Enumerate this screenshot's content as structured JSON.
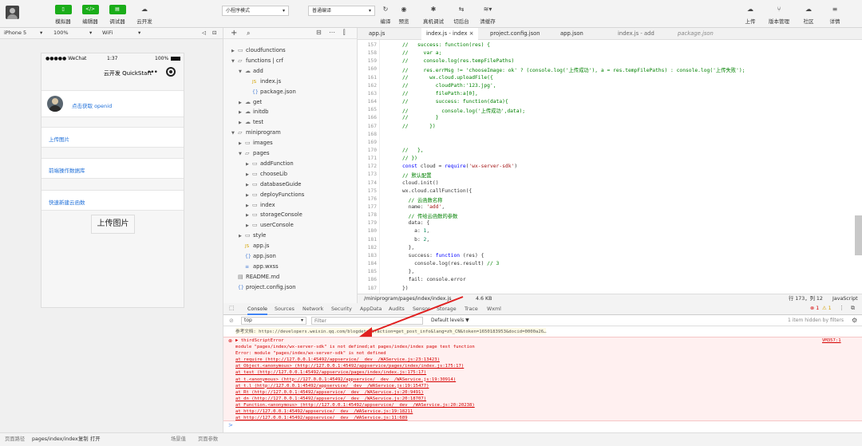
{
  "toolbar": {
    "simulator": "模拟器",
    "editor": "编辑器",
    "debugger": "调试器",
    "cloud": "云开发",
    "mode": "小程序模式",
    "compile": "普通编译",
    "compile_btn": "编译",
    "preview_btn": "预览",
    "remote_debug": "真机调试",
    "background": "切后台",
    "clear_cache": "清缓存",
    "upload": "上传",
    "version": "版本管理",
    "community": "社区",
    "details": "详情"
  },
  "device": {
    "model": "iPhone 5",
    "zoom": "100%",
    "network": "WiFi"
  },
  "phone": {
    "carrier": "●●●●● WeChat",
    "time": "1:37",
    "battery": "100%",
    "title": "云开发 QuickStart",
    "openid_link": "点击获取 openid",
    "upload_image": "上传图片",
    "db_guide": "前端操作数据库",
    "new_cloud_fn": "快速新建云函数",
    "upload_button": "上传图片"
  },
  "tree": [
    {
      "label": "cloudfunctions",
      "indent": 0,
      "arrow": "▶",
      "icon": "folder"
    },
    {
      "label": "functions | crf",
      "indent": 0,
      "arrow": "▼",
      "icon": "folder-open"
    },
    {
      "label": "add",
      "indent": 1,
      "arrow": "▼",
      "icon": "cloud"
    },
    {
      "label": "index.js",
      "indent": 2,
      "arrow": "",
      "icon": "js"
    },
    {
      "label": "package.json",
      "indent": 2,
      "arrow": "",
      "icon": "json"
    },
    {
      "label": "get",
      "indent": 1,
      "arrow": "▶",
      "icon": "cloud"
    },
    {
      "label": "initdb",
      "indent": 1,
      "arrow": "▶",
      "icon": "cloud"
    },
    {
      "label": "test",
      "indent": 1,
      "arrow": "▶",
      "icon": "cloud"
    },
    {
      "label": "miniprogram",
      "indent": 0,
      "arrow": "▼",
      "icon": "folder-open"
    },
    {
      "label": "images",
      "indent": 1,
      "arrow": "▶",
      "icon": "folder"
    },
    {
      "label": "pages",
      "indent": 1,
      "arrow": "▼",
      "icon": "folder-open"
    },
    {
      "label": "addFunction",
      "indent": 2,
      "arrow": "▶",
      "icon": "folder"
    },
    {
      "label": "chooseLib",
      "indent": 2,
      "arrow": "▶",
      "icon": "folder"
    },
    {
      "label": "databaseGuide",
      "indent": 2,
      "arrow": "▶",
      "icon": "folder"
    },
    {
      "label": "deployFunctions",
      "indent": 2,
      "arrow": "▶",
      "icon": "folder"
    },
    {
      "label": "index",
      "indent": 2,
      "arrow": "▶",
      "icon": "folder"
    },
    {
      "label": "storageConsole",
      "indent": 2,
      "arrow": "▶",
      "icon": "folder"
    },
    {
      "label": "userConsole",
      "indent": 2,
      "arrow": "▶",
      "icon": "folder"
    },
    {
      "label": "style",
      "indent": 1,
      "arrow": "▶",
      "icon": "folder"
    },
    {
      "label": "app.js",
      "indent": 1,
      "arrow": "",
      "icon": "js"
    },
    {
      "label": "app.json",
      "indent": 1,
      "arrow": "",
      "icon": "json"
    },
    {
      "label": "app.wxss",
      "indent": 1,
      "arrow": "",
      "icon": "wxss"
    },
    {
      "label": "README.md",
      "indent": 0,
      "arrow": "",
      "icon": "md"
    },
    {
      "label": "project.config.json",
      "indent": 0,
      "arrow": "",
      "icon": "json"
    }
  ],
  "tabs": [
    {
      "label": "app.js",
      "active": false
    },
    {
      "label": "index.js - index  ×",
      "active": true
    },
    {
      "label": "project.config.json",
      "active": false
    },
    {
      "label": "app.json",
      "active": false
    },
    {
      "label": "index.js - add",
      "active": false
    },
    {
      "label": "package.json",
      "active": false
    }
  ],
  "code": [
    {
      "n": "157",
      "t": "//   success: function(res) {",
      "c": "cm"
    },
    {
      "n": "158",
      "t": "//     var a;",
      "c": "cm"
    },
    {
      "n": "159",
      "t": "//     console.log(res.tempFilePaths)",
      "c": "cm"
    },
    {
      "n": "160",
      "t": "//     res.errMsg != 'chooseImage: ok' ? (console.log('上传成功'), a = res.tempFilePaths) : console.log('上传失败');",
      "c": "cm"
    },
    {
      "n": "161",
      "t": "//       wx.cloud.uploadFile({",
      "c": "cm"
    },
    {
      "n": "162",
      "t": "//         cloudPath:'123.jpg',",
      "c": "cm"
    },
    {
      "n": "163",
      "t": "//         filePath:a[0],",
      "c": "cm"
    },
    {
      "n": "164",
      "t": "//         success: function(data){",
      "c": "cm"
    },
    {
      "n": "165",
      "t": "//           console.log('上传成功',data);",
      "c": "cm"
    },
    {
      "n": "166",
      "t": "//         }",
      "c": "cm"
    },
    {
      "n": "167",
      "t": "//       })",
      "c": "cm"
    },
    {
      "n": "168",
      "t": "",
      "c": ""
    },
    {
      "n": "169",
      "t": "",
      "c": ""
    },
    {
      "n": "170",
      "t": "//   },",
      "c": "cm"
    },
    {
      "n": "171",
      "t": "// })",
      "c": "cm"
    },
    {
      "n": "172",
      "t": "const cloud = require('wx-server-sdk')",
      "c": "code"
    },
    {
      "n": "173",
      "t": "// 默认配置",
      "c": "cm"
    },
    {
      "n": "174",
      "t": "cloud.init()",
      "c": "code"
    },
    {
      "n": "175",
      "t": "wx.cloud.callFunction({",
      "c": "code"
    },
    {
      "n": "176",
      "t": "  // 云函数名称",
      "c": "cm"
    },
    {
      "n": "177",
      "t": "  name: 'add',",
      "c": "code"
    },
    {
      "n": "178",
      "t": "  // 传给云函数的参数",
      "c": "cm"
    },
    {
      "n": "179",
      "t": "  data: {",
      "c": "code"
    },
    {
      "n": "180",
      "t": "    a: 1,",
      "c": "code"
    },
    {
      "n": "181",
      "t": "    b: 2,",
      "c": "code"
    },
    {
      "n": "182",
      "t": "  },",
      "c": "code"
    },
    {
      "n": "183",
      "t": "  success: function (res) {",
      "c": "code"
    },
    {
      "n": "184",
      "t": "    console.log(res.result) // 3",
      "c": "code"
    },
    {
      "n": "185",
      "t": "  },",
      "c": "code"
    },
    {
      "n": "186",
      "t": "  fail: console.error",
      "c": "code"
    },
    {
      "n": "187",
      "t": "})",
      "c": "code"
    }
  ],
  "statusbar": {
    "path": "/miniprogram/pages/index/index.js",
    "size": "4.6 KB",
    "position": "行 173，列 12",
    "lang": "JavaScript"
  },
  "devtabs": [
    "Console",
    "Sources",
    "Network",
    "Security",
    "AppData",
    "Audits",
    "Sensor",
    "Storage",
    "Trace",
    "Wxml"
  ],
  "console": {
    "context": "top",
    "filter_placeholder": "Filter",
    "levels": "Default levels ▼",
    "hidden": "1 item hidden by filters",
    "errors": "1",
    "warnings": "1",
    "ref_line": "参考文档: https://developers.weixin.qq.com/blogdetail?action=get_post_info&lang=zh_CN&token=1650183953&docid=0000a26…",
    "error_title": "▶ thirdScriptError",
    "error_src": "VM357:1",
    "error_lines": [
      {
        "text": "module \"pages/index/wx-server-sdk\" is not defined;at pages/index/index page test function",
        "link": false
      },
      {
        "text": "Error: module \"pages/index/wx-server-sdk\" is not defined",
        "link": false
      },
      {
        "text": "    at require (http://127.0.0.1:45492/appservice/__dev__/WAService.js:23:13423)",
        "link": true
      },
      {
        "text": "    at Object.<anonymous> (http://127.0.0.1:45492/appservice/pages/index/index.js:175:17)",
        "link": true
      },
      {
        "text": "    at test (http://127.0.0.1:45492/appservice/pages/index/index.js:175:17)",
        "link": true
      },
      {
        "text": "    at t.<anonymous> (http://127.0.0.1:45492/appservice/__dev__/WAService.js:19:30914)",
        "link": true
      },
      {
        "text": "    at t.l (http://127.0.0.1:45492/appservice/__dev__/WAService.js:19:15477)",
        "link": true
      },
      {
        "text": "    at Rt (http://127.0.0.1:45492/appservice/__dev__/WAService.js:20:9491)",
        "link": true
      },
      {
        "text": "    at dn (http://127.0.0.1:45492/appservice/__dev__/WAService.js:20:18707)",
        "link": true
      },
      {
        "text": "    at Function.<anonymous> (http://127.0.0.1:45492/appservice/__dev__/WAService.js:20:20238)",
        "link": true
      },
      {
        "text": "    at http://127.0.0.1:45492/appservice/__dev__/WAService.js:19:18211",
        "link": true
      },
      {
        "text": "    at http://127.0.0.1:45492/appservice/__dev__/WAService.js:11:689",
        "link": true
      }
    ],
    "prompt": ">"
  },
  "bottombar": {
    "path_label": "页面路径",
    "path": "pages/index/index",
    "copy": "复制",
    "open": "打开",
    "scene": "场景值",
    "params": "页面参数"
  }
}
